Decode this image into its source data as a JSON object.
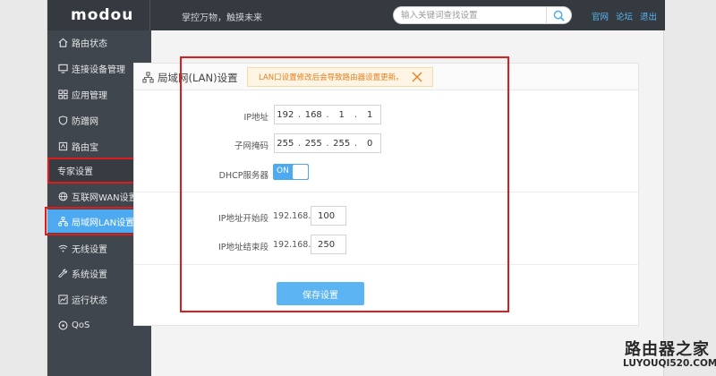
{
  "header": {
    "logo": "modou",
    "slogan": "掌控万物，触摸未来",
    "search_placeholder": "输入关键词查找设置",
    "links": [
      "官网",
      "论坛",
      "退出"
    ]
  },
  "sidebar": {
    "items": [
      {
        "label": "路由状态",
        "icon": "home-icon"
      },
      {
        "label": "连接设备管理",
        "icon": "monitor-icon"
      },
      {
        "label": "应用管理",
        "icon": "apps-grid-icon"
      },
      {
        "label": "防蹭网",
        "icon": "shield-icon"
      },
      {
        "label": "路由宝",
        "icon": "box-icon"
      },
      {
        "label": "专家设置",
        "icon": "chevron-down-icon"
      },
      {
        "label": "互联网WAN设置",
        "icon": "globe-icon"
      },
      {
        "label": "局域网LAN设置",
        "icon": "network-icon"
      },
      {
        "label": "无线设置",
        "icon": "wifi-icon"
      },
      {
        "label": "系统设置",
        "icon": "wrench-icon"
      },
      {
        "label": "运行状态",
        "icon": "chart-icon"
      },
      {
        "label": "QoS",
        "icon": "qos-icon"
      }
    ],
    "active_index": 7
  },
  "panel": {
    "title": "局域网(LAN)设置",
    "notice": "LAN口设置修改后会导致路由器设置更新。",
    "ip_label": "IP地址",
    "ip": [
      "192",
      "168",
      "1",
      "1"
    ],
    "mask_label": "子网掩码",
    "mask": [
      "255",
      "255",
      "255",
      "0"
    ],
    "dhcp_label": "DHCP服务器",
    "dhcp_state": "ON",
    "range_start_label": "IP地址开始段",
    "range_end_label": "IP地址结束段",
    "range_prefix": "192.168.1.",
    "range_start": "100",
    "range_end": "250",
    "save_label": "保存设置"
  },
  "watermark": {
    "cn": "路由器之家",
    "en": "LUYOUQI520.COM"
  },
  "colors": {
    "accent": "#4eaaf0",
    "highlight": "#e01b1b",
    "sidebar_bg": "#3f464d",
    "topbar_bg": "#343a40",
    "notice_text": "#e38020"
  }
}
